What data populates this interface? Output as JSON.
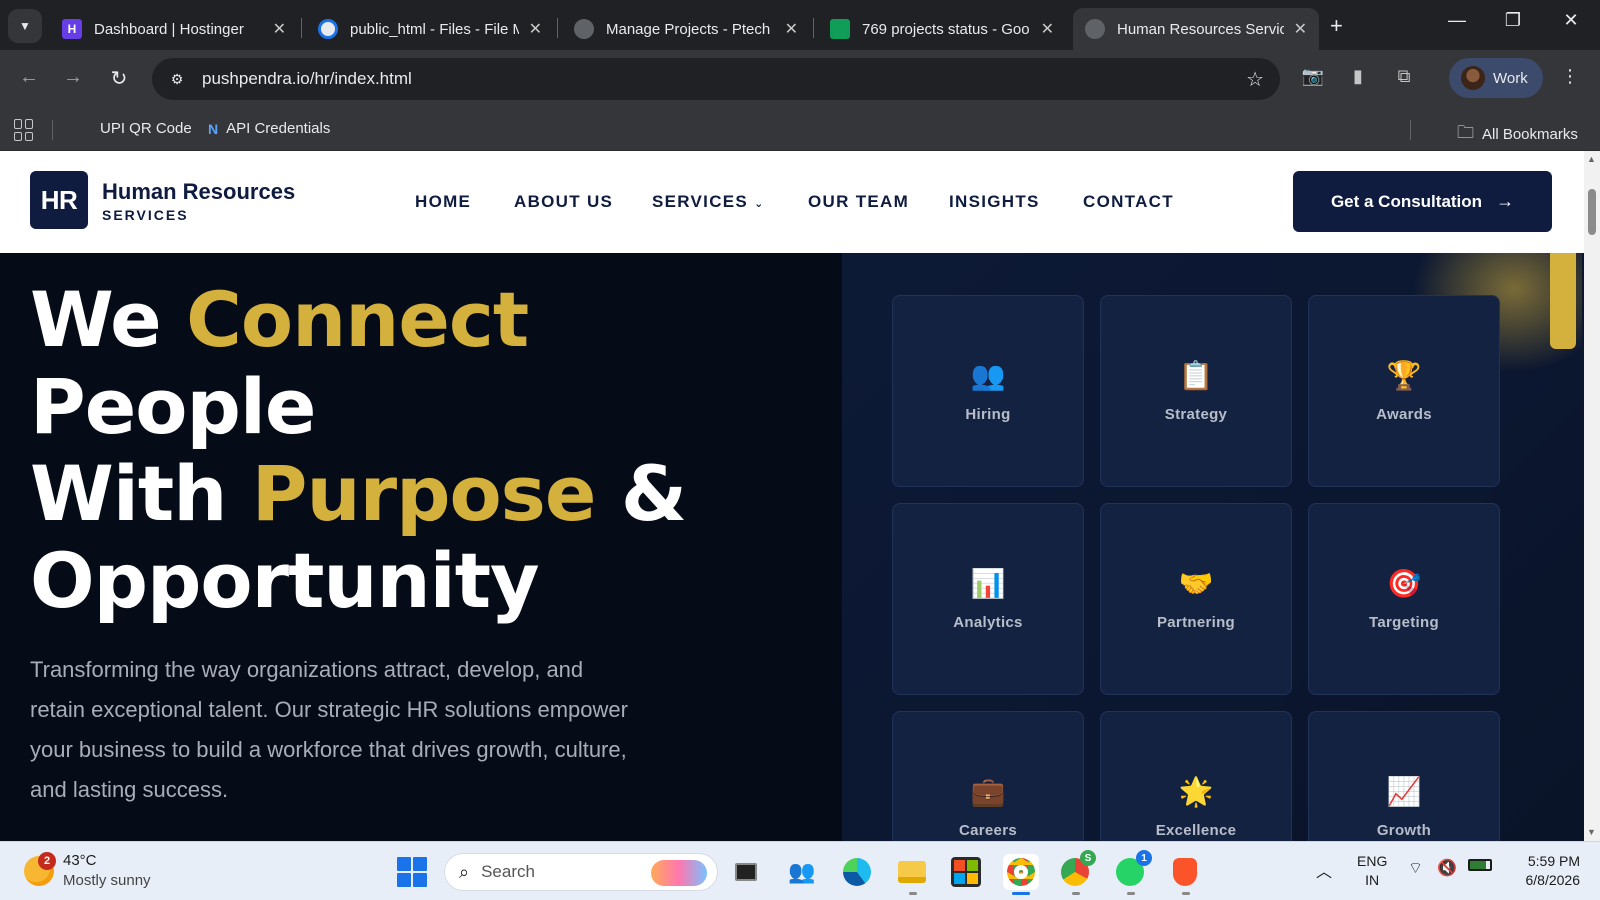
{
  "browser": {
    "tabs": [
      {
        "title": "Dashboard | Hostinger",
        "favicon": "hostinger-icon",
        "active": false
      },
      {
        "title": "public_html - Files - File M",
        "favicon": "file-manager-icon",
        "active": false
      },
      {
        "title": "Manage Projects - Ptech",
        "favicon": "globe-icon",
        "active": false
      },
      {
        "title": "769 projects status - Goo",
        "favicon": "sheets-icon",
        "active": false
      },
      {
        "title": "Human Resources Service",
        "favicon": "globe-icon",
        "active": true
      }
    ],
    "url": "pushpendra.io/hr/index.html",
    "profile_label": "Work",
    "bookmarks": [
      {
        "label": "UPI QR Code"
      },
      {
        "label": "API Credentials"
      }
    ],
    "all_bookmarks_label": "All Bookmarks"
  },
  "site": {
    "logo_mark": "HR",
    "logo_title": "Human Resources",
    "logo_subtitle": "SERVICES",
    "nav": [
      "HOME",
      "ABOUT US",
      "SERVICES",
      "OUR TEAM",
      "INSIGHTS",
      "CONTACT"
    ],
    "cta_label": "Get a Consultation",
    "hero": {
      "line1_a": "We ",
      "line1_b": "Connect",
      "line2": "People",
      "line3_a": "With ",
      "line3_b": "Purpose",
      "line3_c": " &",
      "line4": "Opportunity",
      "copy": "Transforming the way organizations attract, develop, and retain exceptional talent. Our strategic HR solutions empower your business to build a workforce that drives growth, culture, and lasting success."
    },
    "accent_color": "#d4b03c",
    "cards": [
      {
        "label": "Hiring",
        "icon": "👥"
      },
      {
        "label": "Strategy",
        "icon": "📋"
      },
      {
        "label": "Awards",
        "icon": "🏆"
      },
      {
        "label": "Analytics",
        "icon": "📊"
      },
      {
        "label": "Partnering",
        "icon": "🤝"
      },
      {
        "label": "Targeting",
        "icon": "🎯"
      },
      {
        "label": "Careers",
        "icon": "💼"
      },
      {
        "label": "Excellence",
        "icon": "🌟"
      },
      {
        "label": "Growth",
        "icon": "📈"
      }
    ]
  },
  "taskbar": {
    "weather_temp": "43°C",
    "weather_cond": "Mostly sunny",
    "weather_badge": "2",
    "search_placeholder": "Search",
    "whatsapp_badge": "1",
    "chrome_profile_badge": "S",
    "lang_line1": "ENG",
    "lang_line2": "IN",
    "time": "5:59 PM",
    "date": "6/8/2026"
  }
}
